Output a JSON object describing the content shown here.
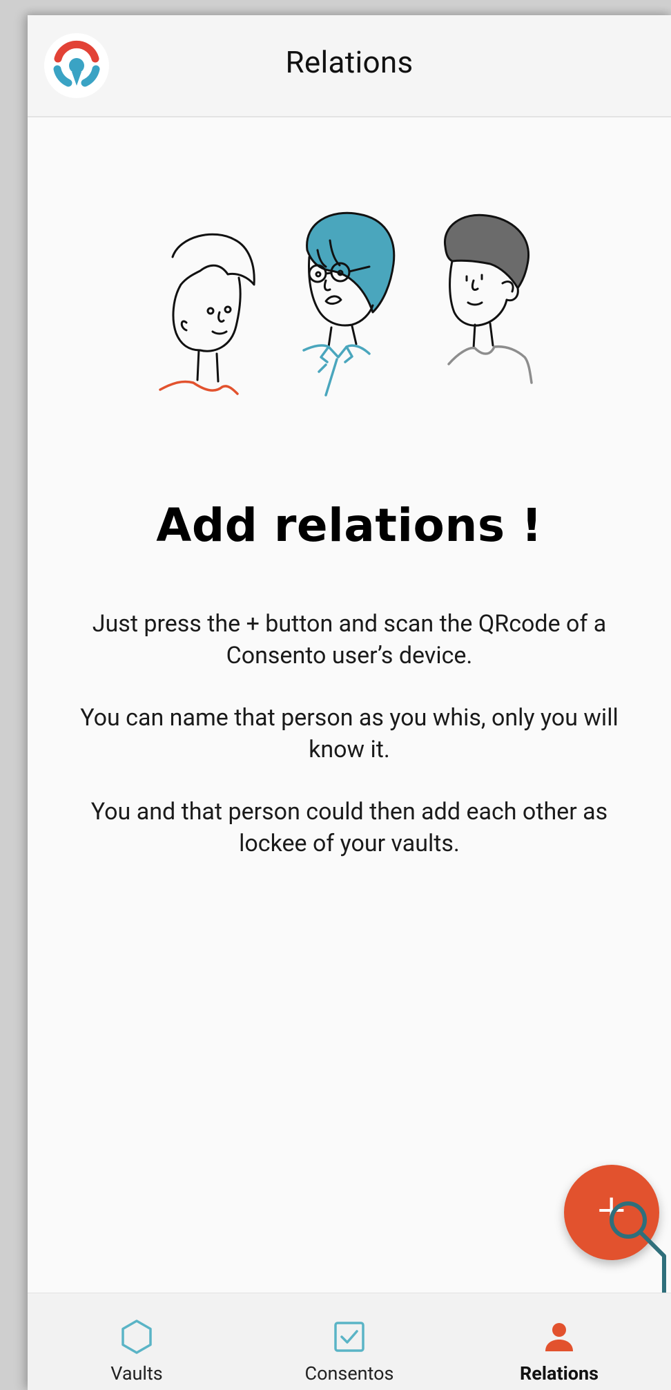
{
  "app_bar": {
    "title": "Relations"
  },
  "empty_state": {
    "headline": "Add relations !",
    "paragraphs": [
      "Just press the + button and scan the QRcode of a Consento user’s device.",
      "You can name that person as you whis, only you will know it.",
      "You and that person could then add each other as lockee of your vaults."
    ]
  },
  "fab": {
    "icon": "plus-icon",
    "label": "+"
  },
  "bottom_nav": {
    "items": [
      {
        "label": "Vaults",
        "icon": "hexagon-icon",
        "active": false
      },
      {
        "label": "Consentos",
        "icon": "checkbox-icon",
        "active": false
      },
      {
        "label": "Relations",
        "icon": "person-icon",
        "active": true
      }
    ]
  },
  "colors": {
    "accent": "#e2522e",
    "teal": "#4aa6bd",
    "logo_red": "#e24236",
    "logo_teal": "#3aa3c4",
    "hair_gray": "#6b6b6b"
  }
}
